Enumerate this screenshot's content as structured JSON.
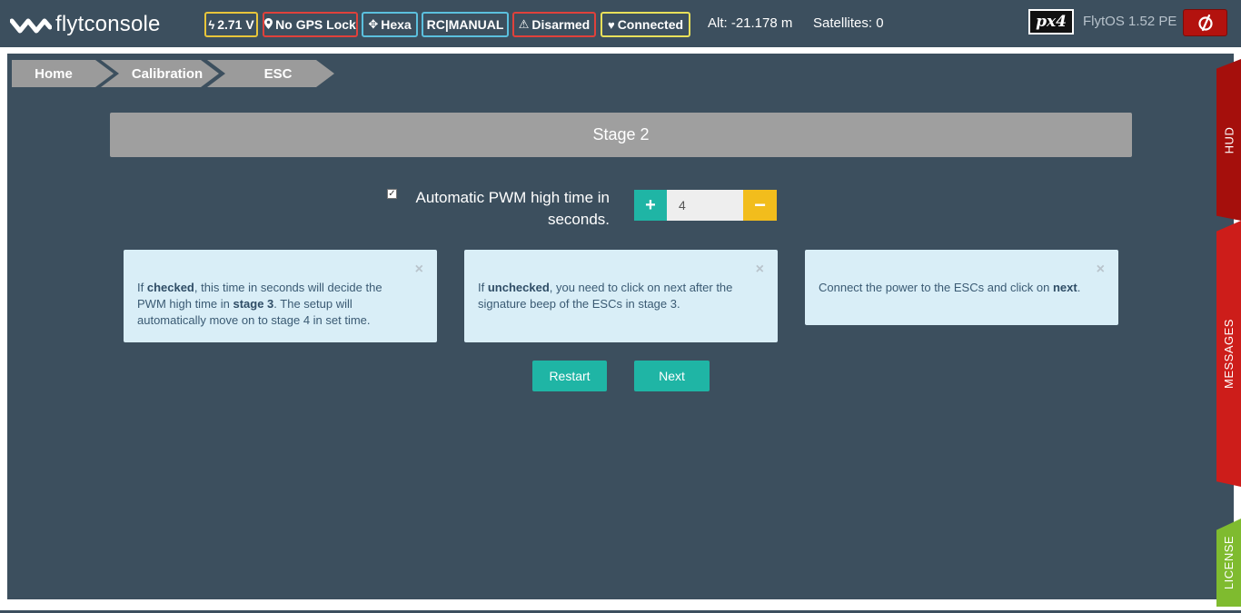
{
  "app": {
    "logo_text_bold": "flyt",
    "logo_text": "console"
  },
  "status_bar": {
    "voltage": {
      "label": "2.71 V",
      "color": "#e8c53a",
      "icon": "bolt-icon"
    },
    "gps": {
      "label": "No GPS Lock",
      "color": "#e0413b",
      "icon": "map-marker-icon"
    },
    "frame": {
      "label": "Hexa",
      "color": "#5bc0de",
      "icon": "move-arrows-icon"
    },
    "rc_mode": {
      "label": "RC|MANUAL",
      "color": "#5bc0de"
    },
    "arm_state": {
      "label": "Disarmed",
      "color": "#e0413b",
      "icon": "warning-triangle-icon"
    },
    "link": {
      "label": "Connected",
      "color": "#e8e05a",
      "icon": "heart-icon"
    },
    "altitude": "Alt: -21.178 m",
    "satellites": "Satellites: 0",
    "autopilot_logo": "px4",
    "os_version": "FlytOS 1.52 PE"
  },
  "breadcrumb": {
    "items": [
      "Home",
      "Calibration",
      "ESC"
    ]
  },
  "stage": {
    "title": "Stage 2"
  },
  "pwm": {
    "checkbox_checked": true,
    "label": "Automatic PWM high time in seconds.",
    "value": "4",
    "plus": "+",
    "minus": "−"
  },
  "info_boxes": [
    {
      "close": "×",
      "p1": "If ",
      "b1": "checked",
      "p2": ", this time in seconds will decide the PWM high time in ",
      "b2": "stage 3",
      "p3": ". The setup will automatically move on to stage 4 in set time."
    },
    {
      "close": "×",
      "p1": "If ",
      "b1": "unchecked",
      "p2": ", you need to click on next after the signature beep of the ESCs in stage 3."
    },
    {
      "close": "×",
      "p1": "Connect the power to the ESCs and click on ",
      "b1": "next",
      "p2": "."
    }
  ],
  "actions": {
    "restart": "Restart",
    "next": "Next"
  },
  "side_tabs": {
    "hud": "HUD",
    "messages": "MESSAGES",
    "license": "LICENSE"
  }
}
